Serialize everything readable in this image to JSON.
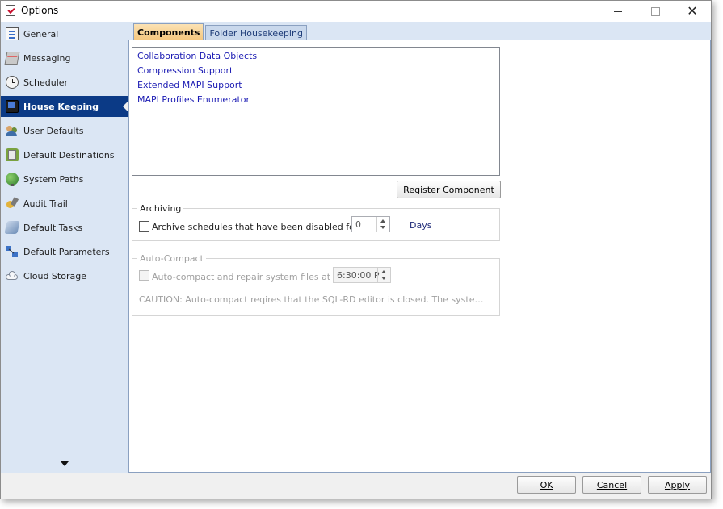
{
  "window": {
    "title": "Options"
  },
  "sidebar": {
    "items": [
      {
        "label": "General",
        "icon": "general-icon"
      },
      {
        "label": "Messaging",
        "icon": "messaging-icon"
      },
      {
        "label": "Scheduler",
        "icon": "clock-icon"
      },
      {
        "label": "House Keeping",
        "icon": "monitor-icon",
        "active": true
      },
      {
        "label": "User Defaults",
        "icon": "users-icon"
      },
      {
        "label": "Default Destinations",
        "icon": "destinations-icon"
      },
      {
        "label": "System Paths",
        "icon": "globe-icon"
      },
      {
        "label": "Audit Trail",
        "icon": "audit-icon"
      },
      {
        "label": "Default Tasks",
        "icon": "tasks-icon"
      },
      {
        "label": "Default Parameters",
        "icon": "parameters-icon"
      },
      {
        "label": "Cloud Storage",
        "icon": "cloud-icon"
      }
    ]
  },
  "tabs": {
    "components": "Components",
    "folder_housekeeping": "Folder Housekeeping"
  },
  "components": {
    "items": [
      "Collaboration Data Objects",
      "Compression Support",
      "Extended MAPI Support",
      "MAPI Profiles Enumerator"
    ],
    "register_button": "Register Component"
  },
  "archiving": {
    "title": "Archiving",
    "checkbox_label": "Archive schedules that have been disabled for",
    "checked": false,
    "value": "0",
    "unit": "Days"
  },
  "autocompact": {
    "title": "Auto-Compact",
    "checkbox_label": "Auto-compact and repair system files at :",
    "checked": false,
    "time_value": "6:30:00 P",
    "caution": "CAUTION: Auto-compact reqires that the SQL-RD editor is closed. The system will close the editor automatically"
  },
  "footer": {
    "ok": "OK",
    "cancel": "Cancel",
    "apply": "Apply"
  },
  "colors": {
    "sidebar_bg": "#dbe6f4",
    "active_item": "#0b3a86",
    "active_tab": "#f4c57a",
    "list_text": "#1a1ab3"
  }
}
